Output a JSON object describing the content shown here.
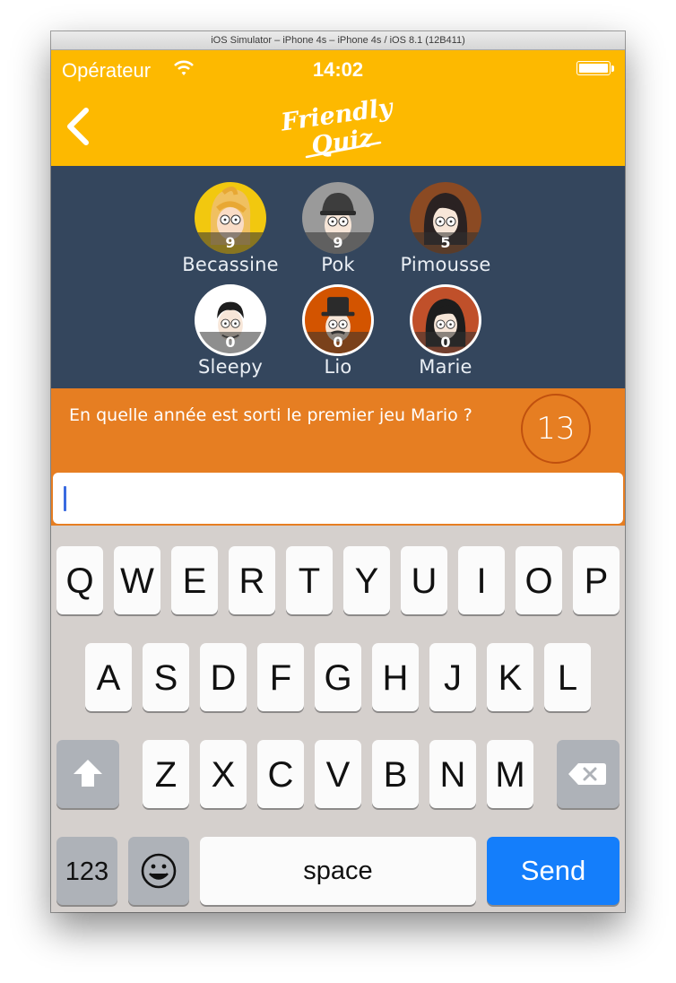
{
  "window": {
    "title": "iOS Simulator – iPhone 4s – iPhone 4s / iOS 8.1 (12B411)"
  },
  "status_bar": {
    "carrier": "Opérateur",
    "time": "14:02"
  },
  "nav": {
    "logo_line1": "Friendly",
    "logo_line2": "Quiz"
  },
  "colors": {
    "header": "#fdb900",
    "players_bg": "#34465d",
    "question_bg": "#e67e22",
    "send": "#147efb"
  },
  "players": [
    {
      "name": "Becassine",
      "score": "9",
      "ring": "#f2c80f"
    },
    {
      "name": "Pok",
      "score": "9",
      "ring": "#9a9a9a"
    },
    {
      "name": "Pimousse",
      "score": "5",
      "ring": "#8b4a23"
    },
    {
      "name": "Sleepy",
      "score": "0",
      "ring": "#ffffff"
    },
    {
      "name": "Lio",
      "score": "0",
      "ring": "#ffffff"
    },
    {
      "name": "Marie",
      "score": "0",
      "ring": "#ffffff"
    }
  ],
  "question": {
    "text": "En quelle année est sorti le premier jeu Mario ?",
    "timer": "13"
  },
  "answer": {
    "value": "",
    "placeholder": ""
  },
  "keyboard": {
    "row1": [
      "Q",
      "W",
      "E",
      "R",
      "T",
      "Y",
      "U",
      "I",
      "O",
      "P"
    ],
    "row2": [
      "A",
      "S",
      "D",
      "F",
      "G",
      "H",
      "J",
      "K",
      "L"
    ],
    "row3": [
      "Z",
      "X",
      "C",
      "V",
      "B",
      "N",
      "M"
    ],
    "numbers_label": "123",
    "space_label": "space",
    "send_label": "Send"
  }
}
